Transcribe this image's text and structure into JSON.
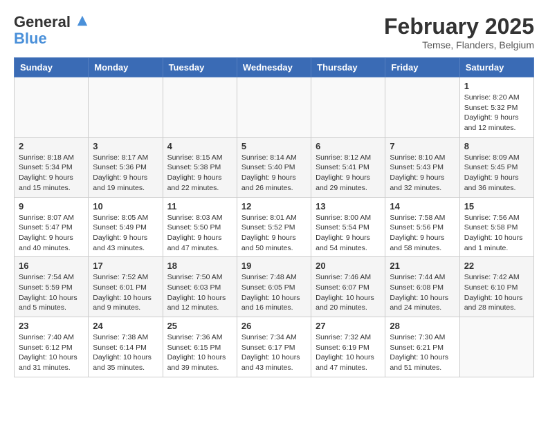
{
  "header": {
    "logo_line1": "General",
    "logo_line2": "Blue",
    "month_title": "February 2025",
    "location": "Temse, Flanders, Belgium"
  },
  "days_of_week": [
    "Sunday",
    "Monday",
    "Tuesday",
    "Wednesday",
    "Thursday",
    "Friday",
    "Saturday"
  ],
  "weeks": [
    [
      {
        "day": "",
        "info": ""
      },
      {
        "day": "",
        "info": ""
      },
      {
        "day": "",
        "info": ""
      },
      {
        "day": "",
        "info": ""
      },
      {
        "day": "",
        "info": ""
      },
      {
        "day": "",
        "info": ""
      },
      {
        "day": "1",
        "info": "Sunrise: 8:20 AM\nSunset: 5:32 PM\nDaylight: 9 hours and 12 minutes."
      }
    ],
    [
      {
        "day": "2",
        "info": "Sunrise: 8:18 AM\nSunset: 5:34 PM\nDaylight: 9 hours and 15 minutes."
      },
      {
        "day": "3",
        "info": "Sunrise: 8:17 AM\nSunset: 5:36 PM\nDaylight: 9 hours and 19 minutes."
      },
      {
        "day": "4",
        "info": "Sunrise: 8:15 AM\nSunset: 5:38 PM\nDaylight: 9 hours and 22 minutes."
      },
      {
        "day": "5",
        "info": "Sunrise: 8:14 AM\nSunset: 5:40 PM\nDaylight: 9 hours and 26 minutes."
      },
      {
        "day": "6",
        "info": "Sunrise: 8:12 AM\nSunset: 5:41 PM\nDaylight: 9 hours and 29 minutes."
      },
      {
        "day": "7",
        "info": "Sunrise: 8:10 AM\nSunset: 5:43 PM\nDaylight: 9 hours and 32 minutes."
      },
      {
        "day": "8",
        "info": "Sunrise: 8:09 AM\nSunset: 5:45 PM\nDaylight: 9 hours and 36 minutes."
      }
    ],
    [
      {
        "day": "9",
        "info": "Sunrise: 8:07 AM\nSunset: 5:47 PM\nDaylight: 9 hours and 40 minutes."
      },
      {
        "day": "10",
        "info": "Sunrise: 8:05 AM\nSunset: 5:49 PM\nDaylight: 9 hours and 43 minutes."
      },
      {
        "day": "11",
        "info": "Sunrise: 8:03 AM\nSunset: 5:50 PM\nDaylight: 9 hours and 47 minutes."
      },
      {
        "day": "12",
        "info": "Sunrise: 8:01 AM\nSunset: 5:52 PM\nDaylight: 9 hours and 50 minutes."
      },
      {
        "day": "13",
        "info": "Sunrise: 8:00 AM\nSunset: 5:54 PM\nDaylight: 9 hours and 54 minutes."
      },
      {
        "day": "14",
        "info": "Sunrise: 7:58 AM\nSunset: 5:56 PM\nDaylight: 9 hours and 58 minutes."
      },
      {
        "day": "15",
        "info": "Sunrise: 7:56 AM\nSunset: 5:58 PM\nDaylight: 10 hours and 1 minute."
      }
    ],
    [
      {
        "day": "16",
        "info": "Sunrise: 7:54 AM\nSunset: 5:59 PM\nDaylight: 10 hours and 5 minutes."
      },
      {
        "day": "17",
        "info": "Sunrise: 7:52 AM\nSunset: 6:01 PM\nDaylight: 10 hours and 9 minutes."
      },
      {
        "day": "18",
        "info": "Sunrise: 7:50 AM\nSunset: 6:03 PM\nDaylight: 10 hours and 12 minutes."
      },
      {
        "day": "19",
        "info": "Sunrise: 7:48 AM\nSunset: 6:05 PM\nDaylight: 10 hours and 16 minutes."
      },
      {
        "day": "20",
        "info": "Sunrise: 7:46 AM\nSunset: 6:07 PM\nDaylight: 10 hours and 20 minutes."
      },
      {
        "day": "21",
        "info": "Sunrise: 7:44 AM\nSunset: 6:08 PM\nDaylight: 10 hours and 24 minutes."
      },
      {
        "day": "22",
        "info": "Sunrise: 7:42 AM\nSunset: 6:10 PM\nDaylight: 10 hours and 28 minutes."
      }
    ],
    [
      {
        "day": "23",
        "info": "Sunrise: 7:40 AM\nSunset: 6:12 PM\nDaylight: 10 hours and 31 minutes."
      },
      {
        "day": "24",
        "info": "Sunrise: 7:38 AM\nSunset: 6:14 PM\nDaylight: 10 hours and 35 minutes."
      },
      {
        "day": "25",
        "info": "Sunrise: 7:36 AM\nSunset: 6:15 PM\nDaylight: 10 hours and 39 minutes."
      },
      {
        "day": "26",
        "info": "Sunrise: 7:34 AM\nSunset: 6:17 PM\nDaylight: 10 hours and 43 minutes."
      },
      {
        "day": "27",
        "info": "Sunrise: 7:32 AM\nSunset: 6:19 PM\nDaylight: 10 hours and 47 minutes."
      },
      {
        "day": "28",
        "info": "Sunrise: 7:30 AM\nSunset: 6:21 PM\nDaylight: 10 hours and 51 minutes."
      },
      {
        "day": "",
        "info": ""
      }
    ]
  ]
}
